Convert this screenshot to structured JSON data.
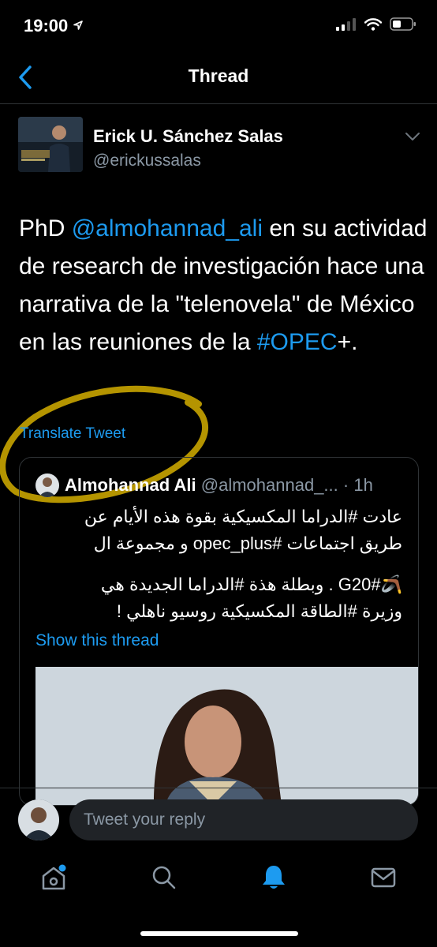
{
  "status_bar": {
    "time": "19:00"
  },
  "nav": {
    "title": "Thread"
  },
  "tweet": {
    "author_name": "Erick U. Sánchez Salas",
    "author_handle": "@erickussalas",
    "text_1": "PhD ",
    "mention": "@almohannad_ali",
    "text_2": " en su actividad de research de investigación hace una narrativa de la \"telenovela\" de México en las reuniones de la ",
    "hashtag": "#OPEC",
    "text_3": "+.",
    "translate_label": "Translate Tweet"
  },
  "quoted_tweet": {
    "author_name": "Almohannad Ali",
    "author_handle": "@almohannad_...",
    "separator": " · ",
    "time": "1h",
    "text_line1": "عادت #الدراما المكسيكية بقوة هذه الأيام عن",
    "text_line2": "طريق اجتماعات #opec_plus و مجموعة ال",
    "text_line3": "🪃#G20 . وبطلة هذة #الدراما الجديدة هي",
    "text_line4": "وزيرة #الطاقة المكسيكية روسيو ناهلي !",
    "show_thread_label": "Show this thread"
  },
  "reply": {
    "placeholder": "Tweet your reply"
  },
  "colors": {
    "accent": "#1d9bf0",
    "background": "#000000",
    "secondary_text": "#8b98a5",
    "highlight": "#c8a400"
  },
  "tabs": [
    {
      "icon": "home-icon",
      "has_notification_dot": true
    },
    {
      "icon": "search-icon"
    },
    {
      "icon": "bell-icon",
      "active": true
    },
    {
      "icon": "mail-icon"
    }
  ]
}
